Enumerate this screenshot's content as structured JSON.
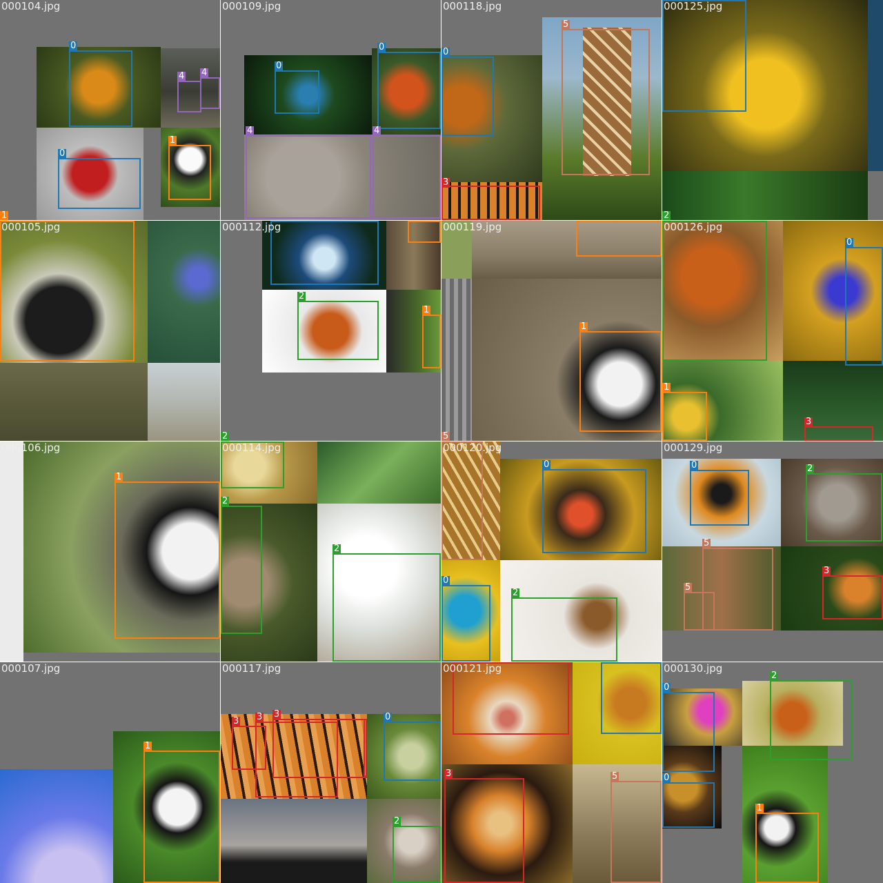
{
  "class_colors": {
    "0": "#1f77b4",
    "1": "#ff7f0e",
    "2": "#2ca02c",
    "3": "#d62728",
    "4": "#9467bd",
    "5": "#c5765b"
  },
  "tiles": [
    {
      "filename": "000104.jpg"
    },
    {
      "filename": "000109.jpg"
    },
    {
      "filename": "000118.jpg"
    },
    {
      "filename": "000125.jpg"
    },
    {
      "filename": "000105.jpg"
    },
    {
      "filename": "000112.jpg"
    },
    {
      "filename": "000119.jpg"
    },
    {
      "filename": "000126.jpg"
    },
    {
      "filename": "000106.jpg"
    },
    {
      "filename": "000114.jpg"
    },
    {
      "filename": "000120.jpg"
    },
    {
      "filename": "000129.jpg"
    },
    {
      "filename": "000107.jpg"
    },
    {
      "filename": "000117.jpg"
    },
    {
      "filename": "000121.jpg"
    },
    {
      "filename": "000130.jpg"
    }
  ]
}
